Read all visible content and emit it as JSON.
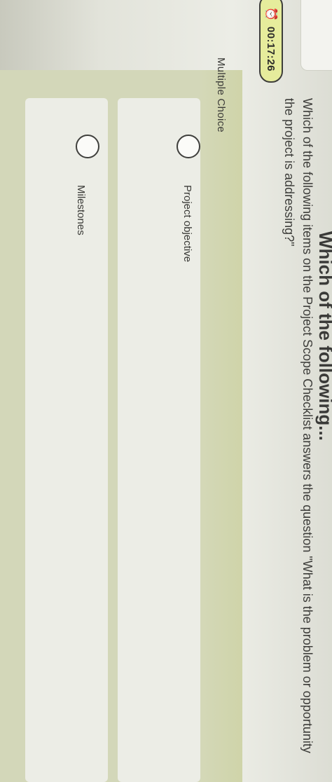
{
  "header": {
    "title": "Which of the following..."
  },
  "timer": {
    "icon": "alarm-clock-icon",
    "value": "00:17:26"
  },
  "question": {
    "text": "Which of the following items on the Project Scope Checklist answers the question \"What is the problem or opportunity the project is addressing?\""
  },
  "section": {
    "label": "Multiple Choice"
  },
  "options": [
    {
      "label": "Project objective",
      "selected": false
    },
    {
      "label": "Milestones",
      "selected": false
    }
  ]
}
